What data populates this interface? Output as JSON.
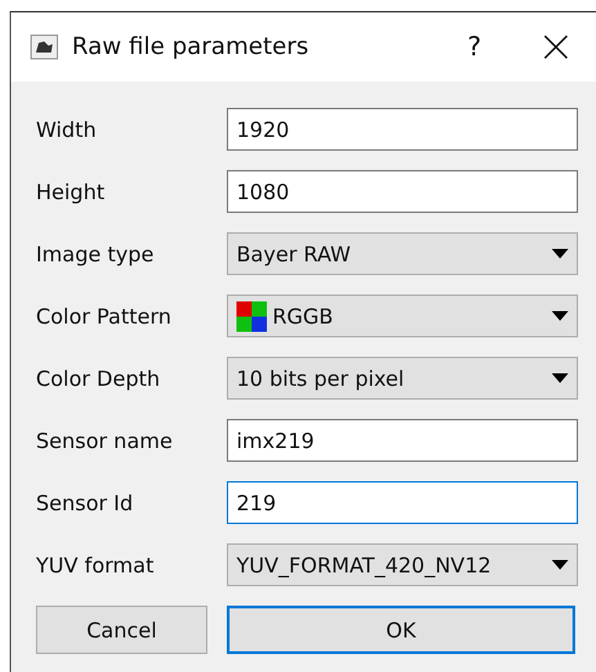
{
  "window": {
    "title": "Raw file parameters",
    "help": "?"
  },
  "fields": [
    {
      "label": "Width",
      "kind": "text",
      "value": "1920",
      "focused": false
    },
    {
      "label": "Height",
      "kind": "text",
      "value": "1080",
      "focused": false
    },
    {
      "label": "Image type",
      "kind": "dropdown",
      "value": "Bayer RAW"
    },
    {
      "label": "Color Pattern",
      "kind": "dropdown",
      "value": "RGGB",
      "swatch": true
    },
    {
      "label": "Color Depth",
      "kind": "dropdown",
      "value": "10 bits per pixel"
    },
    {
      "label": "Sensor name",
      "kind": "text",
      "value": "imx219",
      "focused": false
    },
    {
      "label": "Sensor Id",
      "kind": "text",
      "value": "219",
      "focused": true
    },
    {
      "label": "YUV format",
      "kind": "dropdown",
      "value": "YUV_FORMAT_420_NV12"
    }
  ],
  "buttons": [
    {
      "label": "Cancel",
      "default": false
    },
    {
      "label": "OK",
      "default": true
    }
  ]
}
